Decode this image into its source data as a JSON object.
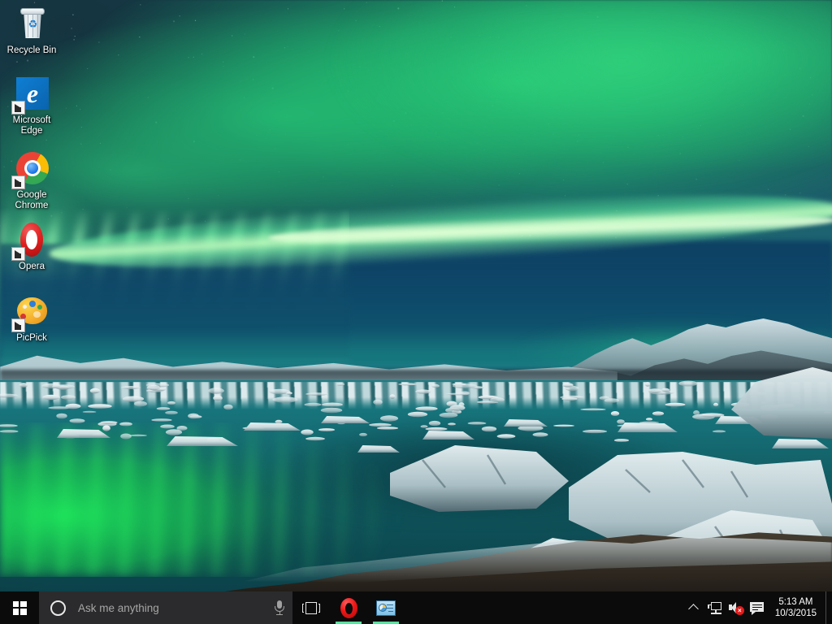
{
  "desktop": {
    "wallpaper_description": "Aurora borealis over Jokulsarlon glacier lagoon, Iceland",
    "icons": [
      {
        "id": "recycle-bin",
        "label": "Recycle Bin",
        "icon": "recycle-bin-icon",
        "shortcut": false
      },
      {
        "id": "microsoft-edge",
        "label": "Microsoft Edge",
        "icon": "edge-icon",
        "shortcut": true
      },
      {
        "id": "google-chrome",
        "label": "Google Chrome",
        "icon": "chrome-icon",
        "shortcut": true
      },
      {
        "id": "opera",
        "label": "Opera",
        "icon": "opera-icon",
        "shortcut": true
      },
      {
        "id": "picpick",
        "label": "PicPick",
        "icon": "picpick-icon",
        "shortcut": true
      }
    ]
  },
  "taskbar": {
    "start_button_label": "Start",
    "search": {
      "placeholder": "Ask me anything",
      "value": "",
      "cortana_icon": "cortana-circle-icon",
      "mic_icon": "microphone-icon"
    },
    "task_view_label": "Task View",
    "apps": [
      {
        "id": "opera",
        "label": "Opera",
        "icon": "opera-icon",
        "running": true
      },
      {
        "id": "system-properties",
        "label": "System",
        "icon": "system-properties-icon",
        "running": true
      }
    ],
    "tray": {
      "overflow_label": "Show hidden icons",
      "icons": [
        {
          "id": "network",
          "label": "Network",
          "icon": "network-icon"
        },
        {
          "id": "volume",
          "label": "Volume muted",
          "icon": "speaker-muted-icon"
        },
        {
          "id": "action-center",
          "label": "Action Center",
          "icon": "action-center-icon"
        }
      ],
      "clock": {
        "time": "5:13 AM",
        "date": "10/3/2015"
      },
      "show_desktop_label": "Show desktop"
    }
  },
  "colors": {
    "taskbar_bg": "#0b0b0c",
    "search_bg": "#2b2b2d",
    "running_indicator": "#58e3a0",
    "aurora_green": "#28d278",
    "sky_blue": "#0e466a",
    "lagoon_teal": "#166e76",
    "mute_badge_red": "#e11d1d"
  }
}
